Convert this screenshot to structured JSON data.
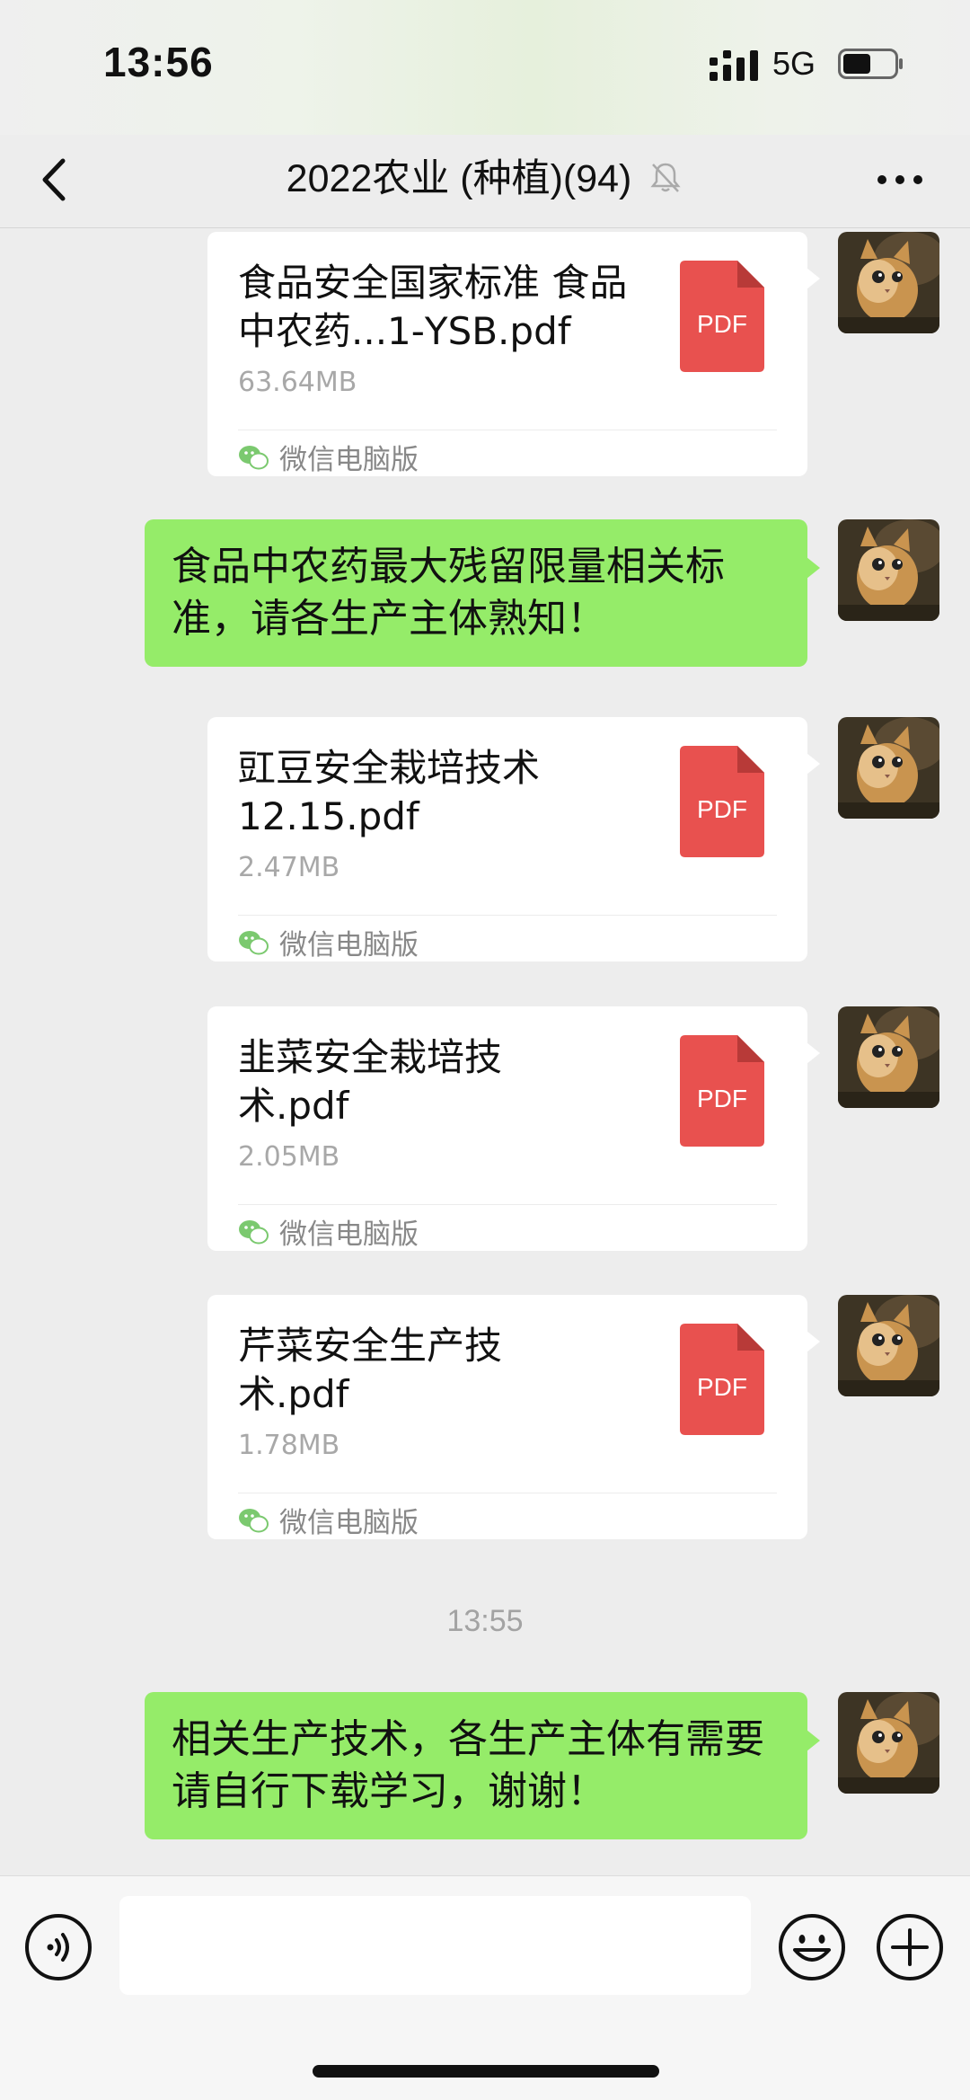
{
  "status_bar": {
    "time": "13:56",
    "network": "5G",
    "battery_level": 0.55
  },
  "nav": {
    "title": "2022农业 (种植)(94)",
    "muted": true
  },
  "messages": [
    {
      "type": "file",
      "name": "食品安全国家标准 食品中农药...1-YSB.pdf",
      "size": "63.64MB",
      "source": "微信电脑版",
      "icon": "pdf-icon",
      "icon_label": "PDF"
    },
    {
      "type": "text",
      "text": "食品中农药最大残留限量相关标准，请各生产主体熟知！"
    },
    {
      "type": "file",
      "name": "豇豆安全栽培技术12.15.pdf",
      "size": "2.47MB",
      "source": "微信电脑版",
      "icon": "pdf-icon",
      "icon_label": "PDF"
    },
    {
      "type": "file",
      "name": "韭菜安全栽培技术.pdf",
      "size": "2.05MB",
      "source": "微信电脑版",
      "icon": "pdf-icon",
      "icon_label": "PDF"
    },
    {
      "type": "file",
      "name": "芹菜安全生产技术.pdf",
      "size": "1.78MB",
      "source": "微信电脑版",
      "icon": "pdf-icon",
      "icon_label": "PDF"
    },
    {
      "type": "timestamp",
      "text": "13:55"
    },
    {
      "type": "text",
      "text": "相关生产技术，各生产主体有需要请自行下载学习，谢谢！"
    }
  ],
  "input_bar": {
    "value": "",
    "icons": [
      "voice-icon",
      "emoji-icon",
      "plus-icon"
    ]
  },
  "colors": {
    "bubble_green": "#95ec69",
    "pdf_red": "#e8514f",
    "background": "#ededed"
  }
}
